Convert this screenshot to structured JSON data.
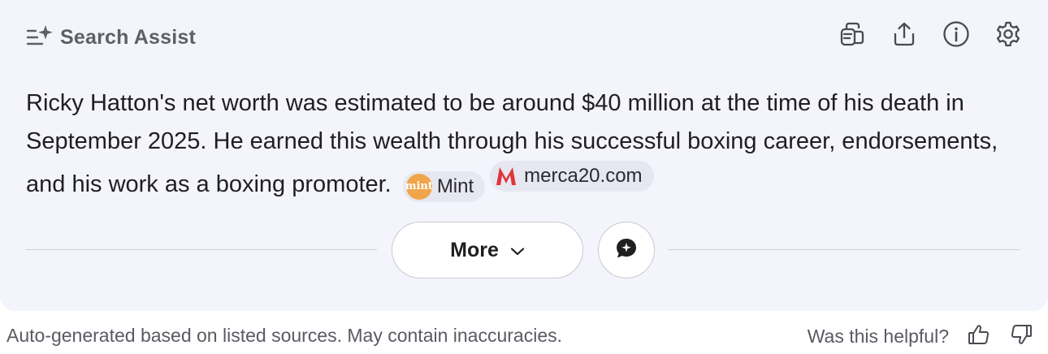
{
  "header": {
    "title": "Search Assist",
    "icon": "sparkle-list-icon",
    "tools": [
      "copy-icon",
      "share-icon",
      "info-icon",
      "settings-gear-icon"
    ]
  },
  "answer": {
    "text": "Ricky Hatton's net worth was estimated to be around $40 million at the time of his death in September 2025. He earned this wealth through his successful boxing career, endorsements, and his work as a boxing promoter.",
    "sources": [
      {
        "label": "Mint",
        "logo_text": "mint",
        "color": "#f0a54a"
      },
      {
        "label": "merca20.com",
        "logo_text": "M",
        "color": "#e0262b"
      }
    ]
  },
  "actions": {
    "more_label": "More",
    "chat_icon": "chat-bubble-icon"
  },
  "footer": {
    "note": "Auto-generated based on listed sources. May contain inaccuracies.",
    "helpful_question": "Was this helpful?"
  },
  "colors": {
    "panel_bg": "#f4f4fc",
    "chip_bg": "#e7e7f1",
    "muted_text": "#5a5a63"
  }
}
